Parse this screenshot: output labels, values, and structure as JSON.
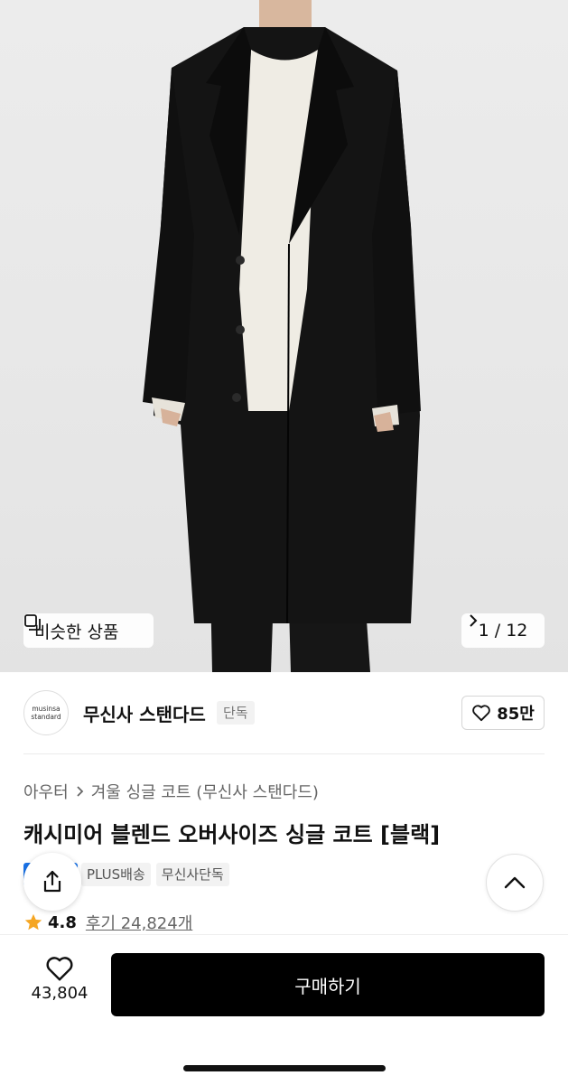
{
  "hero": {
    "similar_label": "비슷한 상품",
    "counter": "1 / 12"
  },
  "brand": {
    "logo_line1": "musinsa",
    "logo_line2": "standard",
    "name": "무신사 스탠다드",
    "badge": "단독",
    "favorites": "85만"
  },
  "product": {
    "breadcrumb": [
      "아우터",
      "겨울 싱글 코트 (무신사 스탠다드)"
    ],
    "title": "캐시미어 블렌드 오버사이즈 싱글 코트 [블랙]",
    "tags": [
      "PLUS배송",
      "무신사단독"
    ],
    "rating": "4.8",
    "review_label": "후기 24,824개"
  },
  "bottom": {
    "like_count": "43,804",
    "buy_label": "구매하기"
  },
  "colors": {
    "buy_button": "#000000",
    "star": "#f5a623",
    "accent_blue": "#1a73e8"
  },
  "icons": [
    "similar-products-icon",
    "chevron-right-icon",
    "heart-icon",
    "share-icon",
    "chevron-up-icon",
    "star-icon"
  ]
}
